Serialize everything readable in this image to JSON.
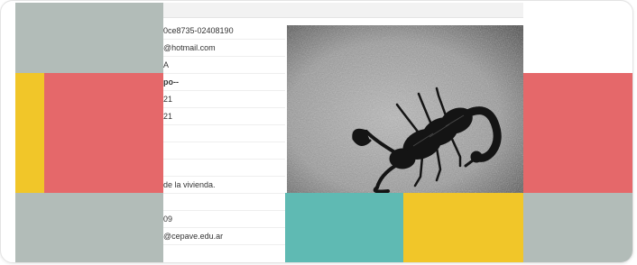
{
  "document_rows": [
    {
      "text": "0ce8735-02408190"
    },
    {
      "text": "@hotmail.com"
    },
    {
      "text": "A"
    },
    {
      "text": "po--"
    },
    {
      "text": "21"
    },
    {
      "text": "21"
    },
    {
      "text": ""
    },
    {
      "text": ""
    },
    {
      "text": ""
    },
    {
      "text": "de la vivienda."
    },
    {
      "text": ""
    },
    {
      "text": "09"
    },
    {
      "text": "@cepave.edu.ar"
    }
  ],
  "photo": {
    "subject": "scorpion",
    "icon": "scorpion-photo"
  },
  "colors": {
    "grey_block": "#b2bcb8",
    "red_block": "#e5686a",
    "yellow_block": "#f1c629",
    "teal_block": "#5fbab3"
  }
}
